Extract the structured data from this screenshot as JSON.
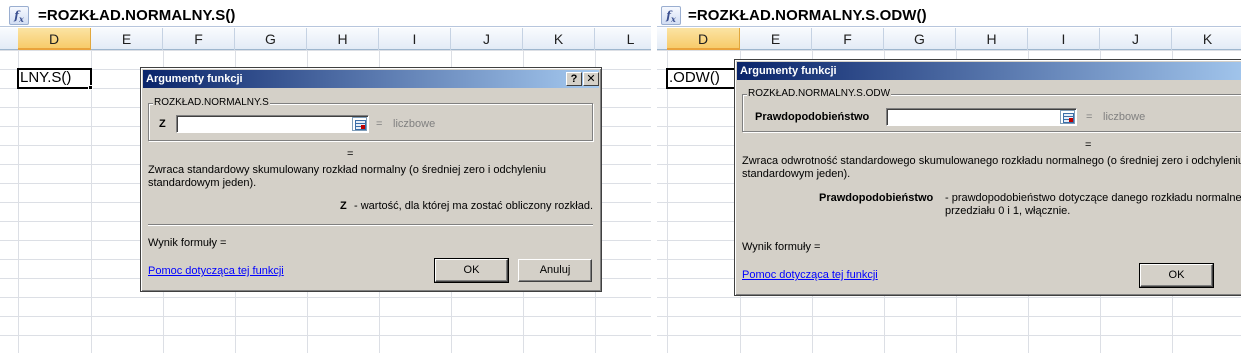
{
  "left": {
    "formula": "=ROZKŁAD.NORMALNY.S()",
    "columns": [
      "D",
      "E",
      "F",
      "G",
      "H",
      "I",
      "J",
      "K",
      "L"
    ],
    "active_column": "D",
    "active_cell_text": "LNY.S()",
    "dialog": {
      "title": "Argumenty funkcji",
      "help_btn": "?",
      "close_btn": "✕",
      "group_label": "ROZKŁAD.NORMALNY.S",
      "arg_label": "Z",
      "arg_eq": "=",
      "arg_type": "liczbowe",
      "result_eq": "=",
      "description": "Zwraca standardowy skumulowany rozkład normalny (o średniej zero i odchyleniu standardowym jeden).",
      "param_name": "Z",
      "param_desc": "- wartość, dla której ma zostać obliczony rozkład.",
      "formula_result_label": "Wynik formuły =",
      "help_link": "Pomoc dotycząca tej funkcji",
      "ok": "OK",
      "cancel": "Anuluj"
    }
  },
  "right": {
    "formula": "=ROZKŁAD.NORMALNY.S.ODW()",
    "columns": [
      "D",
      "E",
      "F",
      "G",
      "H",
      "I",
      "J",
      "K"
    ],
    "active_column": "D",
    "active_cell_text": ".ODW()",
    "dialog": {
      "title": "Argumenty funkcji",
      "group_label": "ROZKŁAD.NORMALNY.S.ODW",
      "arg_label": "Prawdopodobieństwo",
      "arg_eq": "=",
      "arg_type": "liczbowe",
      "result_eq": "=",
      "description": "Zwraca odwrotność standardowego skumulowanego rozkładu normalnego (o średniej zero i odchyleniu standardowym jeden).",
      "param_name": "Prawdopodobieństwo",
      "param_desc": "- prawdopodobieństwo dotyczące danego rozkładu normalne przedziału 0 i 1, włącznie.",
      "formula_result_label": "Wynik formuły =",
      "help_link": "Pomoc dotycząca tej funkcji",
      "ok": "OK"
    }
  },
  "icons": {
    "function_button": "fx-icon",
    "range_selector": "collapse-dialog-icon"
  },
  "colors": {
    "active_column_header": "#f7cb6a",
    "dialog_face": "#d4d0c8",
    "title_bar": "#0a246a",
    "link": "#0000ff"
  }
}
